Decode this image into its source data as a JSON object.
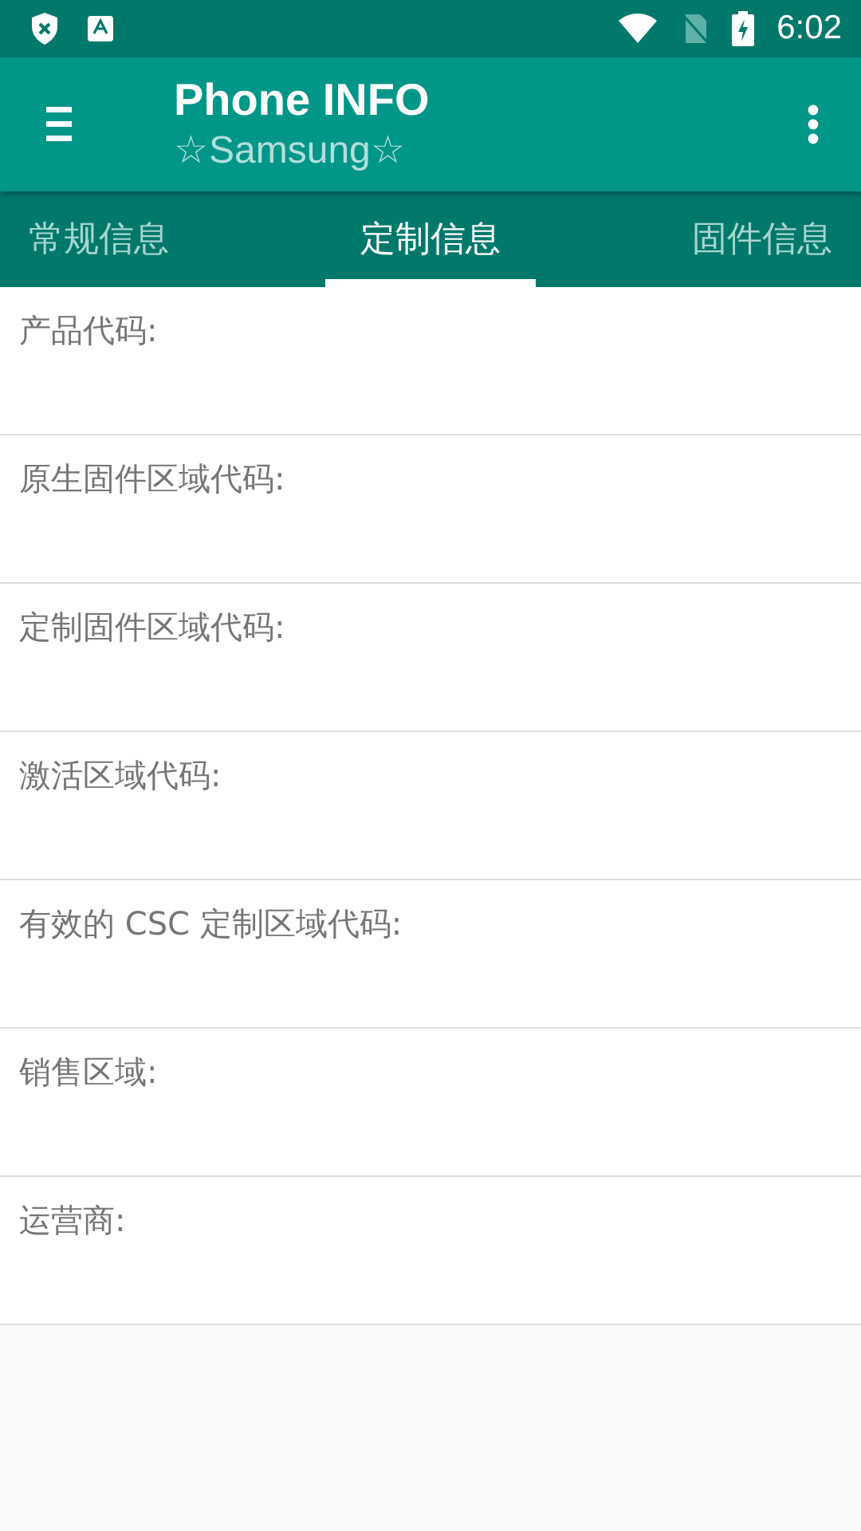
{
  "status_bar": {
    "time": "6:02"
  },
  "toolbar": {
    "title": "Phone INFO",
    "subtitle": "☆Samsung☆"
  },
  "tabs": [
    {
      "label": "常规信息",
      "selected": false
    },
    {
      "label": "定制信息",
      "selected": true
    },
    {
      "label": "固件信息",
      "selected": false
    }
  ],
  "fields": [
    {
      "label": "产品代码:"
    },
    {
      "label": "原生固件区域代码:"
    },
    {
      "label": "定制固件区域代码:"
    },
    {
      "label": "激活区域代码:"
    },
    {
      "label": "有效的 CSC 定制区域代码:"
    },
    {
      "label": "销售区域:"
    },
    {
      "label": "运营商:"
    }
  ]
}
